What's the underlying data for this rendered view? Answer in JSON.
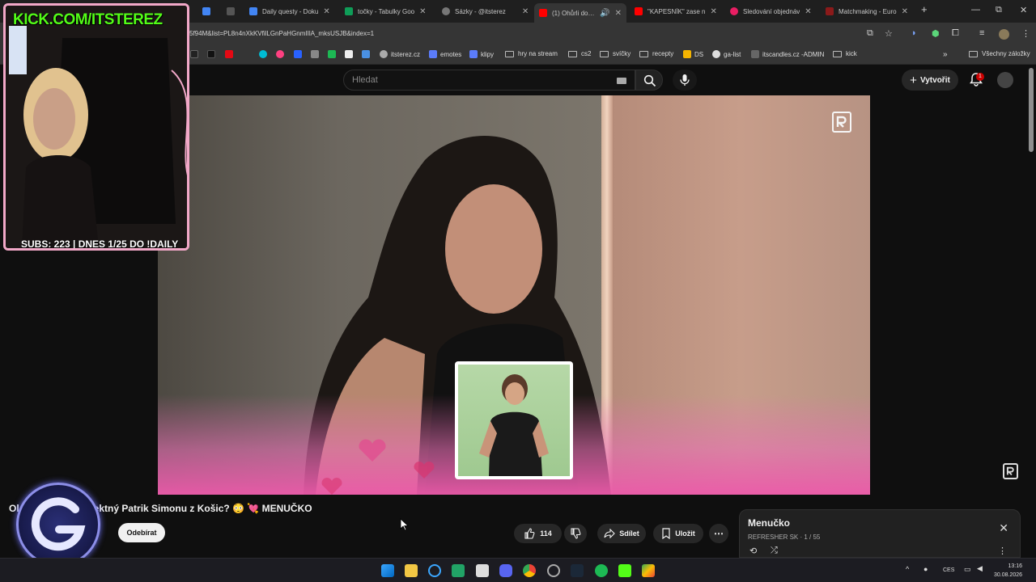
{
  "browser": {
    "tabs": [
      {
        "label": "Daily questy - Doku",
        "color": "#4285f4"
      },
      {
        "label": "točky - Tabulky Goo",
        "color": "#0f9d58"
      },
      {
        "label": "Sázky - @itsterez",
        "color": "#888888"
      },
      {
        "label": "(1) Ohůrli doslo",
        "color": "#ff0000"
      },
      {
        "label": "\"KAPESNÍK\" zase n",
        "color": "#ff0000"
      },
      {
        "label": "Sledování objednáv",
        "color": "#e91e63"
      },
      {
        "label": "Matchmaking - Euro",
        "color": "#8b1a1a"
      }
    ],
    "new_tab": "+",
    "window_controls": {
      "minimize": "—",
      "maximize": "⧉",
      "close": "✕"
    },
    "url": "5f94M&list=PL8n4nXkKVfilLGnPaHGnmIIlA_mksUSJB&index=1",
    "bookmarks": [
      {
        "label": "",
        "color": "#222222",
        "icon": "x-icon"
      },
      {
        "label": "",
        "color": "#111111",
        "icon": "tiktok-icon"
      },
      {
        "label": "",
        "color": "#e50914",
        "icon": "netflix-icon"
      },
      {
        "label": "",
        "color": "#00bcd4",
        "icon": "bookmark-icon"
      },
      {
        "label": "",
        "color": "#ff4081",
        "icon": "bookmark-icon"
      },
      {
        "label": "",
        "color": "#2962ff",
        "icon": "paypal-icon"
      },
      {
        "label": "",
        "color": "#888888",
        "icon": "bookmark-icon"
      },
      {
        "label": "",
        "color": "#1db954",
        "icon": "bookmark-icon"
      },
      {
        "label": "",
        "color": "#eeeeee",
        "icon": "bookmark-icon"
      },
      {
        "label": "",
        "color": "#4a90e2",
        "icon": "bookmark-icon"
      },
      {
        "label": "itsterez.cz",
        "color": "#aaaaaa",
        "icon": "globe-icon"
      },
      {
        "label": "emotes",
        "color": "#5b7cfa",
        "icon": "bookmark-icon"
      },
      {
        "label": "klipy",
        "color": "#5b7cfa",
        "icon": "bookmark-icon"
      },
      {
        "label": "hry na stream",
        "folder": true
      },
      {
        "label": "cs2",
        "folder": true
      },
      {
        "label": "svíčky",
        "folder": true
      },
      {
        "label": "recepty",
        "folder": true
      },
      {
        "label": "DS",
        "color": "#f5b400",
        "icon": "bookmark-icon"
      },
      {
        "label": "ga-list",
        "color": "#dddddd",
        "icon": "github-icon"
      },
      {
        "label": "itscandles.cz -ADMIN",
        "color": "#666666",
        "icon": "bookmark-icon"
      },
      {
        "label": "kick",
        "folder": true
      }
    ],
    "all_bookmarks": "Všechny záložky"
  },
  "youtube": {
    "search_placeholder": "Hledat",
    "create_label": "Vytvořit",
    "notification_count": "1",
    "video_title": "fektný Patrik Simonu z Košic? 😳 💘 MENUČKO",
    "title_prefix": "Ol",
    "subscribe_label": "Odebírat",
    "likes": "114",
    "share_label": "Sdílet",
    "save_label": "Uložit",
    "playlist": {
      "title": "Menučko",
      "subtitle": "REFRESHER SK · 1 / 55"
    }
  },
  "stream_overlay": {
    "kick_url": "KICK.COM/ITSTEREZ",
    "subs_line": "SUBS: 223 | DNES 1/25 DO !DAILY",
    "accent_color": "#53fc18",
    "frame_color": "#f2a8c8"
  },
  "taskbar": {
    "lang": "CES",
    "time": "13:16",
    "date": "30.08.2026"
  }
}
